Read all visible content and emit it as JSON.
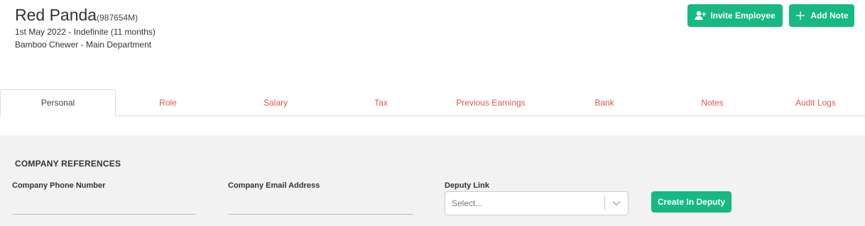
{
  "employee": {
    "name": "Red Panda",
    "id": "(987654M)",
    "dates": "1st May 2022 - Indefinite (11 months)",
    "department": "Bamboo Chewer - Main Department"
  },
  "actions": {
    "invite_label": "Invite Employee",
    "add_note_label": "Add Note"
  },
  "tabs": [
    {
      "label": "Personal",
      "active": true
    },
    {
      "label": "Role"
    },
    {
      "label": "Salary"
    },
    {
      "label": "Tax"
    },
    {
      "label": "Previous Earnings"
    },
    {
      "label": "Bank"
    },
    {
      "label": "Notes"
    },
    {
      "label": "Audit Logs"
    }
  ],
  "company_references": {
    "title": "COMPANY REFERENCES",
    "phone_label": "Company Phone Number",
    "phone_value": "",
    "email_label": "Company Email Address",
    "email_value": "",
    "deputy_label": "Deputy Link",
    "deputy_placeholder": "Select...",
    "create_deputy_label": "Create In Deputy"
  },
  "colors": {
    "accent": "#16b883",
    "tab_text": "#e2574c",
    "panel_bg": "#f2f2f2"
  }
}
